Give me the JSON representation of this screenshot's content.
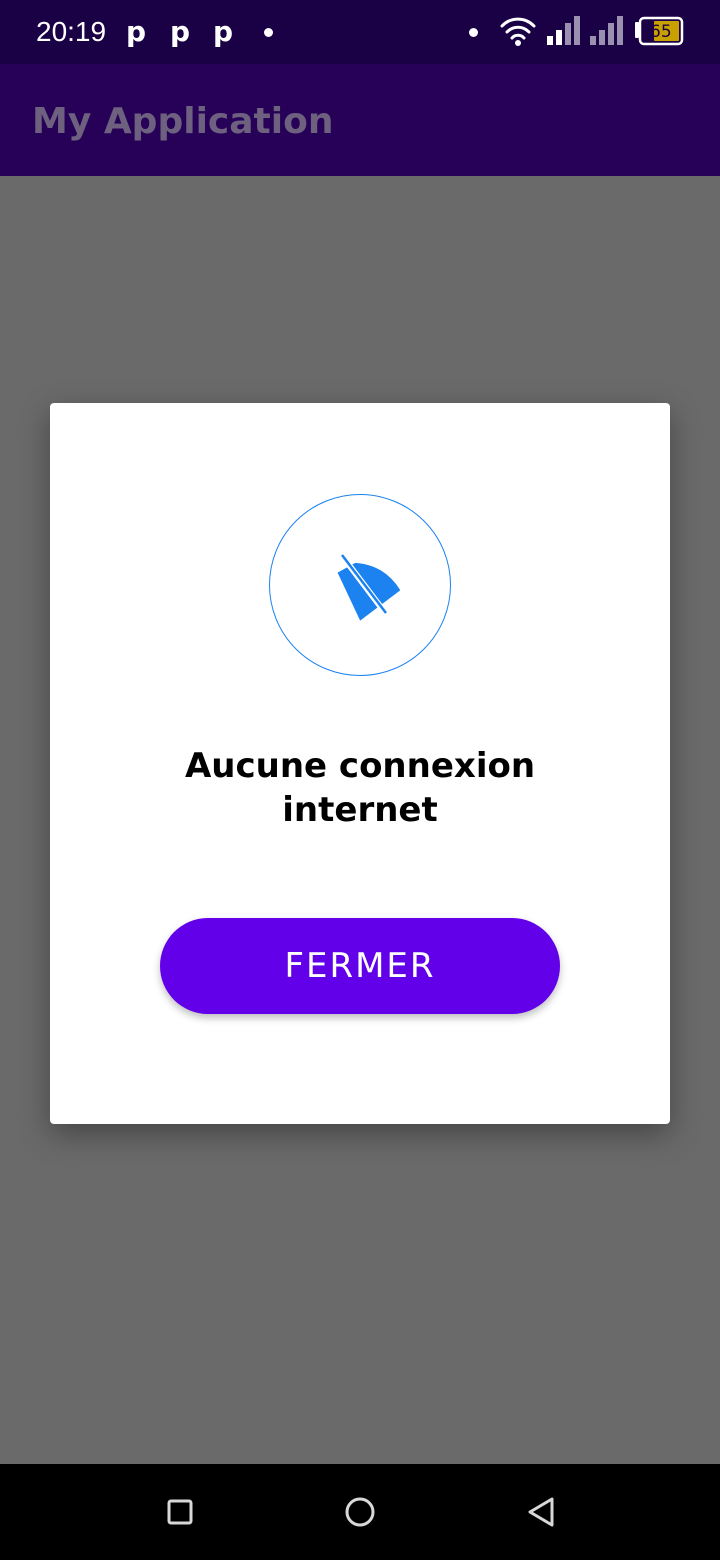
{
  "status_bar": {
    "time": "20:19",
    "notification_icons": [
      "p",
      "p",
      "p"
    ],
    "battery_level": "65"
  },
  "app_bar": {
    "title": "My Application"
  },
  "dialog": {
    "icon": "wifi-off-icon",
    "message": "Aucune connexion\ninternet",
    "close_button_label": "FERMER"
  },
  "colors": {
    "status_bar": "#1a0045",
    "app_bar": "#270058",
    "scrim": "#6a6a6a",
    "accent": "#6200ea",
    "icon_blue": "#1b82f0"
  },
  "nav_bar": {
    "buttons": [
      "recents-square-icon",
      "home-circle-icon",
      "back-triangle-icon"
    ]
  }
}
